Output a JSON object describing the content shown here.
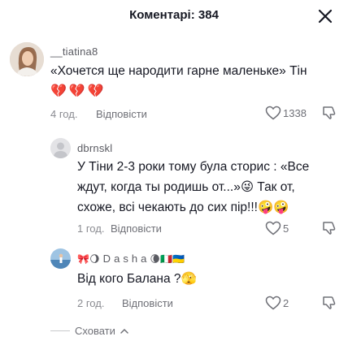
{
  "header": {
    "title": "Коментарі: 384"
  },
  "comments": [
    {
      "username": "__tiatina8",
      "text": "«Хочется ще народити гарне маленьке» Тін",
      "emojis": "💔💔💔",
      "time": "4 год.",
      "reply_label": "Відповісти",
      "likes": "1338"
    },
    {
      "username": "dbrnskl",
      "text": "У Тіни 2-3 роки тому була сторис : «Все ждут, когда ты родишь от...»😜 Так от, схоже, всі чекають до сих пір!!!🤪🤪",
      "line1": "У Тіни 2-3 роки тому була сторис : «Все",
      "line2": "ждут, когда ты родишь от...»😜 Так от,",
      "line3": "схоже, всі чекають до сих пір!!!🤪🤪",
      "time": "1 год.",
      "reply_label": "Відповісти",
      "likes": "5"
    },
    {
      "username": "🎀🌖D a s h a 🌘🇮🇹🇺🇦",
      "username_text": "D a s h a",
      "text": "Від кого Балана ?🫣",
      "time": "2 год.",
      "reply_label": "Відповісти",
      "likes": "2"
    }
  ],
  "footer": {
    "hide_label": "Сховати"
  },
  "colors": {
    "text": "#161823",
    "muted": "#8a8b91",
    "bg": "#ffffff"
  },
  "icons": [
    "close-icon",
    "heart-outline-icon",
    "dislike-icon",
    "chevron-up-icon"
  ]
}
